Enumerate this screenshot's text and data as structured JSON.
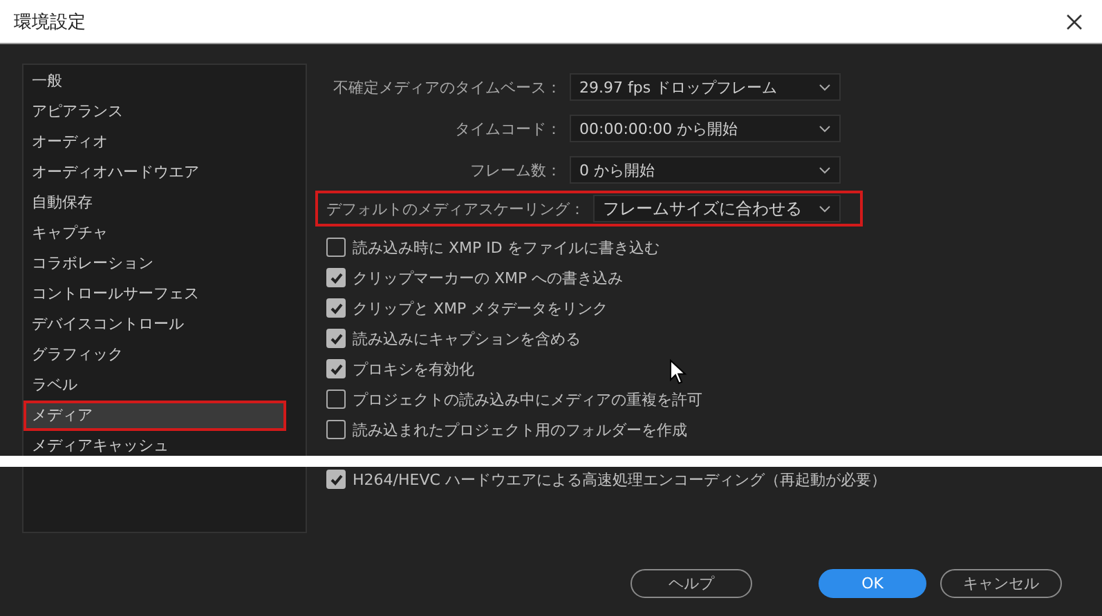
{
  "window": {
    "title": "環境設定"
  },
  "sidebar": {
    "items": [
      {
        "label": "一般",
        "selected": false,
        "highlighted": false
      },
      {
        "label": "アピアランス",
        "selected": false,
        "highlighted": false
      },
      {
        "label": "オーディオ",
        "selected": false,
        "highlighted": false
      },
      {
        "label": "オーディオハードウエア",
        "selected": false,
        "highlighted": false
      },
      {
        "label": "自動保存",
        "selected": false,
        "highlighted": false
      },
      {
        "label": "キャプチャ",
        "selected": false,
        "highlighted": false
      },
      {
        "label": "コラボレーション",
        "selected": false,
        "highlighted": false
      },
      {
        "label": "コントロールサーフェス",
        "selected": false,
        "highlighted": false
      },
      {
        "label": "デバイスコントロール",
        "selected": false,
        "highlighted": false
      },
      {
        "label": "グラフィック",
        "selected": false,
        "highlighted": false
      },
      {
        "label": "ラベル",
        "selected": false,
        "highlighted": false
      },
      {
        "label": "メディア",
        "selected": true,
        "highlighted": true
      },
      {
        "label": "メディアキャッシュ",
        "selected": false,
        "highlighted": false
      }
    ]
  },
  "settings": {
    "dropdowns": [
      {
        "label": "不確定メディアのタイムベース：",
        "value": "29.97 fps ドロップフレーム",
        "highlighted": false
      },
      {
        "label": "タイムコード：",
        "value": "00:00:00:00 から開始",
        "highlighted": false
      },
      {
        "label": "フレーム数：",
        "value": "0 から開始",
        "highlighted": false
      },
      {
        "label": "デフォルトのメディアスケーリング：",
        "value": "フレームサイズに合わせる",
        "highlighted": true
      }
    ],
    "checkboxes": [
      {
        "label": "読み込み時に XMP ID をファイルに書き込む",
        "checked": false
      },
      {
        "label": "クリップマーカーの XMP への書き込み",
        "checked": true
      },
      {
        "label": "クリップと XMP メタデータをリンク",
        "checked": true
      },
      {
        "label": "読み込みにキャプションを含める",
        "checked": true
      },
      {
        "label": "プロキシを有効化",
        "checked": true
      },
      {
        "label": "プロジェクトの読み込み中にメディアの重複を許可",
        "checked": false
      },
      {
        "label": "読み込まれたプロジェクト用のフォルダーを作成",
        "checked": false
      }
    ],
    "lower_checkboxes": [
      {
        "label": "H264/HEVC ハードウエアによる高速処理エンコーディング（再起動が必要）",
        "checked": true
      }
    ]
  },
  "buttons": [
    {
      "label": "ヘルプ",
      "kind": "secondary"
    },
    {
      "label": "OK",
      "kind": "primary"
    },
    {
      "label": "キャンセル",
      "kind": "secondary"
    }
  ]
}
